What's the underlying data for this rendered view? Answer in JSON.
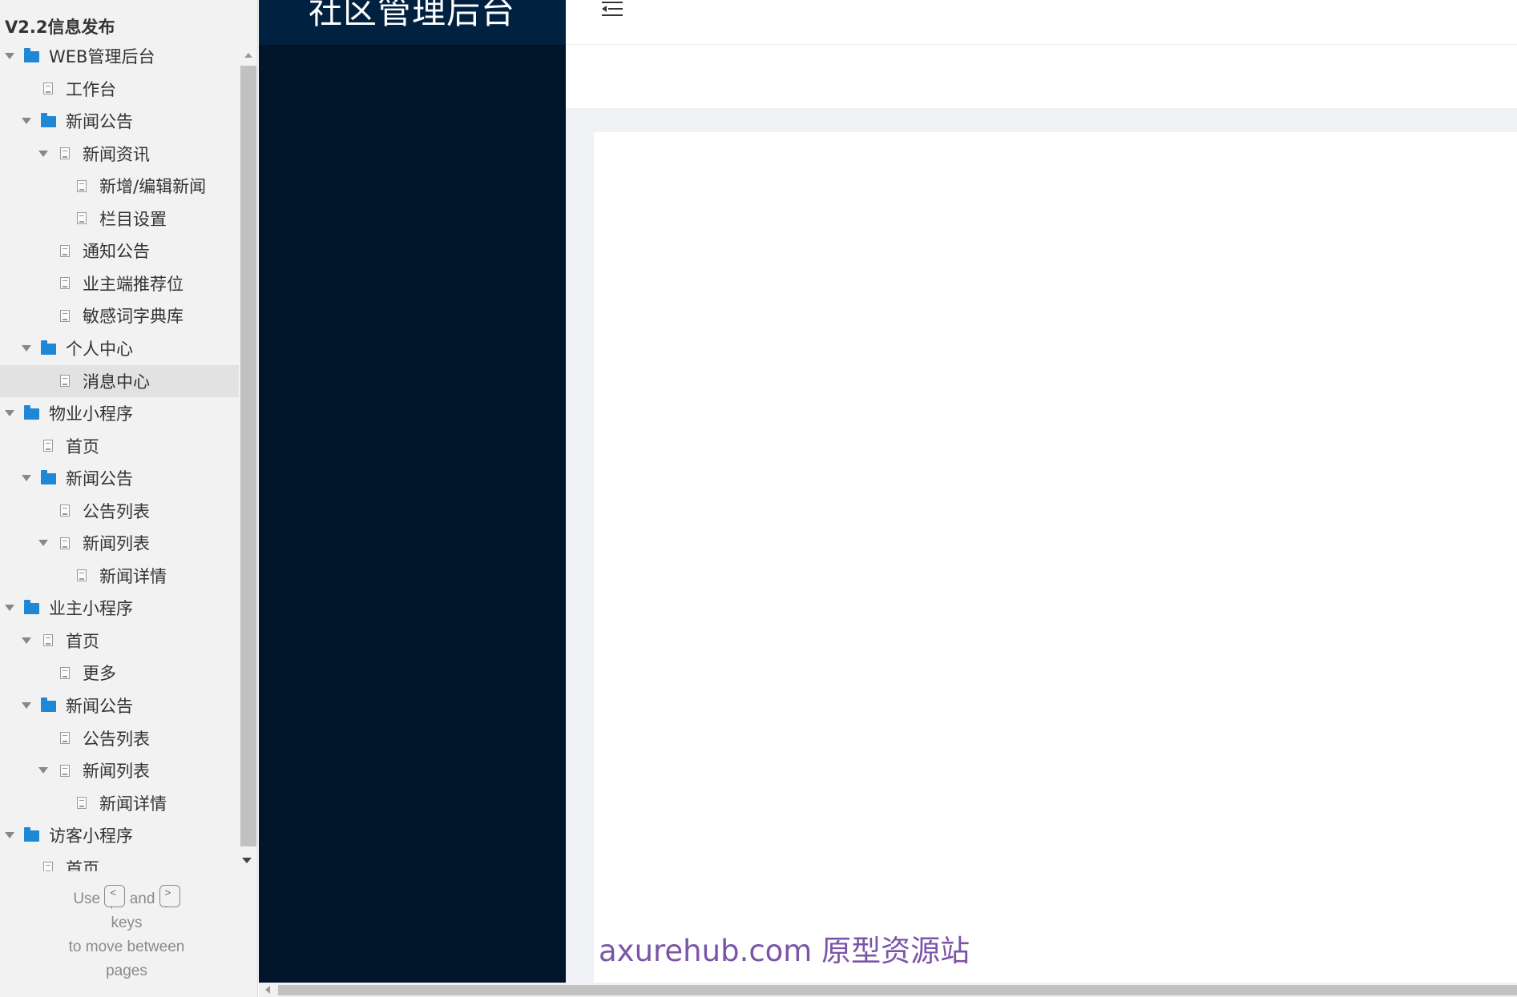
{
  "sitemap": {
    "project_title": "V2.2信息发布",
    "items": [
      {
        "label": "WEB管理后台",
        "type": "folder",
        "level": 0,
        "expanded": true
      },
      {
        "label": "工作台",
        "type": "page",
        "level": 1
      },
      {
        "label": "新闻公告",
        "type": "folder",
        "level": 1,
        "expanded": true
      },
      {
        "label": "新闻资讯",
        "type": "page",
        "level": 2,
        "expanded": true
      },
      {
        "label": "新增/编辑新闻",
        "type": "page",
        "level": 3
      },
      {
        "label": "栏目设置",
        "type": "page",
        "level": 3
      },
      {
        "label": "通知公告",
        "type": "page",
        "level": 2
      },
      {
        "label": "业主端推荐位",
        "type": "page",
        "level": 2
      },
      {
        "label": "敏感词字典库",
        "type": "page",
        "level": 2
      },
      {
        "label": "个人中心",
        "type": "folder",
        "level": 1,
        "expanded": true
      },
      {
        "label": "消息中心",
        "type": "page",
        "level": 2,
        "selected": true
      },
      {
        "label": "物业小程序",
        "type": "folder",
        "level": 0,
        "expanded": true
      },
      {
        "label": "首页",
        "type": "page",
        "level": 1
      },
      {
        "label": "新闻公告",
        "type": "folder",
        "level": 1,
        "expanded": true
      },
      {
        "label": "公告列表",
        "type": "page",
        "level": 2
      },
      {
        "label": "新闻列表",
        "type": "page",
        "level": 2,
        "expanded": true
      },
      {
        "label": "新闻详情",
        "type": "page",
        "level": 3
      },
      {
        "label": "业主小程序",
        "type": "folder",
        "level": 0,
        "expanded": true
      },
      {
        "label": "首页",
        "type": "page",
        "level": 1,
        "expanded": true
      },
      {
        "label": "更多",
        "type": "page",
        "level": 2
      },
      {
        "label": "新闻公告",
        "type": "folder",
        "level": 1,
        "expanded": true
      },
      {
        "label": "公告列表",
        "type": "page",
        "level": 2
      },
      {
        "label": "新闻列表",
        "type": "page",
        "level": 2,
        "expanded": true
      },
      {
        "label": "新闻详情",
        "type": "page",
        "level": 3
      },
      {
        "label": "访客小程序",
        "type": "folder",
        "level": 0,
        "expanded": true
      },
      {
        "label": "首页",
        "type": "page",
        "level": 1
      }
    ],
    "hint": {
      "use": "Use",
      "and": "and",
      "keys": "keys",
      "to_move": "to move between",
      "pages": "pages"
    }
  },
  "prototype": {
    "logo_text": "社区管理后台",
    "watermark": "axurehub.com 原型资源站"
  },
  "colors": {
    "sidebar_bg": "#001529",
    "logo_bg": "#002140",
    "folder_icon": "#1e88d6",
    "watermark": "#7b54a8"
  }
}
